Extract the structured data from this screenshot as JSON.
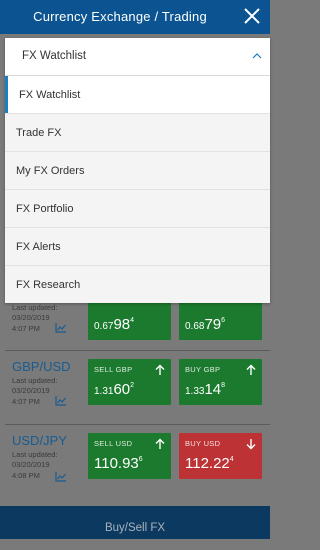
{
  "header": {
    "title": "Currency Exchange / Trading"
  },
  "dropdown": {
    "selected": "FX Watchlist"
  },
  "menu": {
    "items": [
      {
        "label": "FX Watchlist"
      },
      {
        "label": "Trade FX"
      },
      {
        "label": "My FX Orders"
      },
      {
        "label": "FX Portfolio"
      },
      {
        "label": "FX Alerts"
      },
      {
        "label": "FX Research"
      }
    ]
  },
  "watchlist": [
    {
      "pair": "",
      "last_updated_label": "Last updated:",
      "date": "03/20/2019",
      "time": "4:07 PM",
      "sell": {
        "label": "",
        "pre": "0.67",
        "big": "98",
        "sup": "4",
        "direction": "none"
      },
      "buy": {
        "label": "",
        "pre": "0.68",
        "big": "79",
        "sup": "6",
        "direction": "none"
      }
    },
    {
      "pair": "GBP/USD",
      "last_updated_label": "Last updated:",
      "date": "03/20/2019",
      "time": "4:07 PM",
      "sell": {
        "label": "SELL GBP",
        "pre": "1.31",
        "big": "60",
        "sup": "2",
        "direction": "up"
      },
      "buy": {
        "label": "BUY GBP",
        "pre": "1.33",
        "big": "14",
        "sup": "8",
        "direction": "up"
      }
    },
    {
      "pair": "USD/JPY",
      "last_updated_label": "Last updated:",
      "date": "03/20/2019",
      "time": "4:08 PM",
      "sell": {
        "label": "SELL USD",
        "pre": "110.",
        "big": "93",
        "sup": "6",
        "direction": "up"
      },
      "buy": {
        "label": "BUY USD",
        "pre": "112.",
        "big": "22",
        "sup": "4",
        "direction": "down"
      }
    }
  ],
  "footer": {
    "label": "Buy/Sell FX"
  },
  "colors": {
    "header": "#0c5491",
    "sell_tile": "#1b7a2e",
    "buy_up_tile": "#1b7a2e",
    "buy_down_tile": "#bd3235",
    "active_bar": "#1a7fc4",
    "footer": "#0c3960"
  }
}
